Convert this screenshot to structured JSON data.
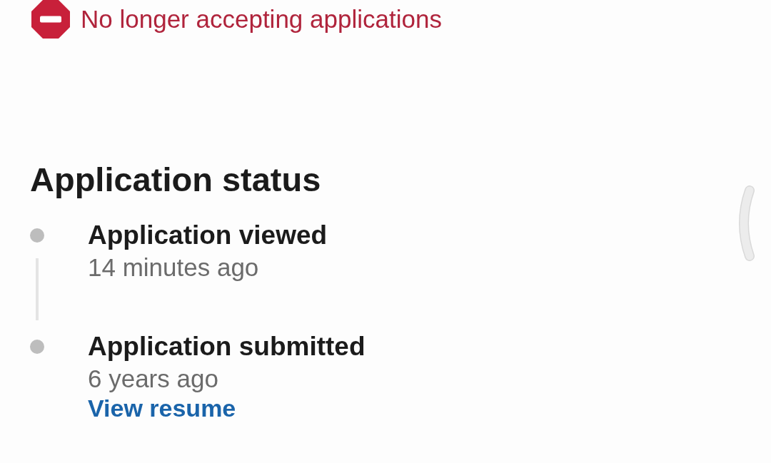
{
  "banner": {
    "text": "No longer accepting applications"
  },
  "status_section": {
    "title": "Application status",
    "timeline": [
      {
        "title": "Application viewed",
        "time": "14 minutes ago"
      },
      {
        "title": "Application submitted",
        "time": "6 years ago",
        "link": "View resume"
      }
    ]
  }
}
